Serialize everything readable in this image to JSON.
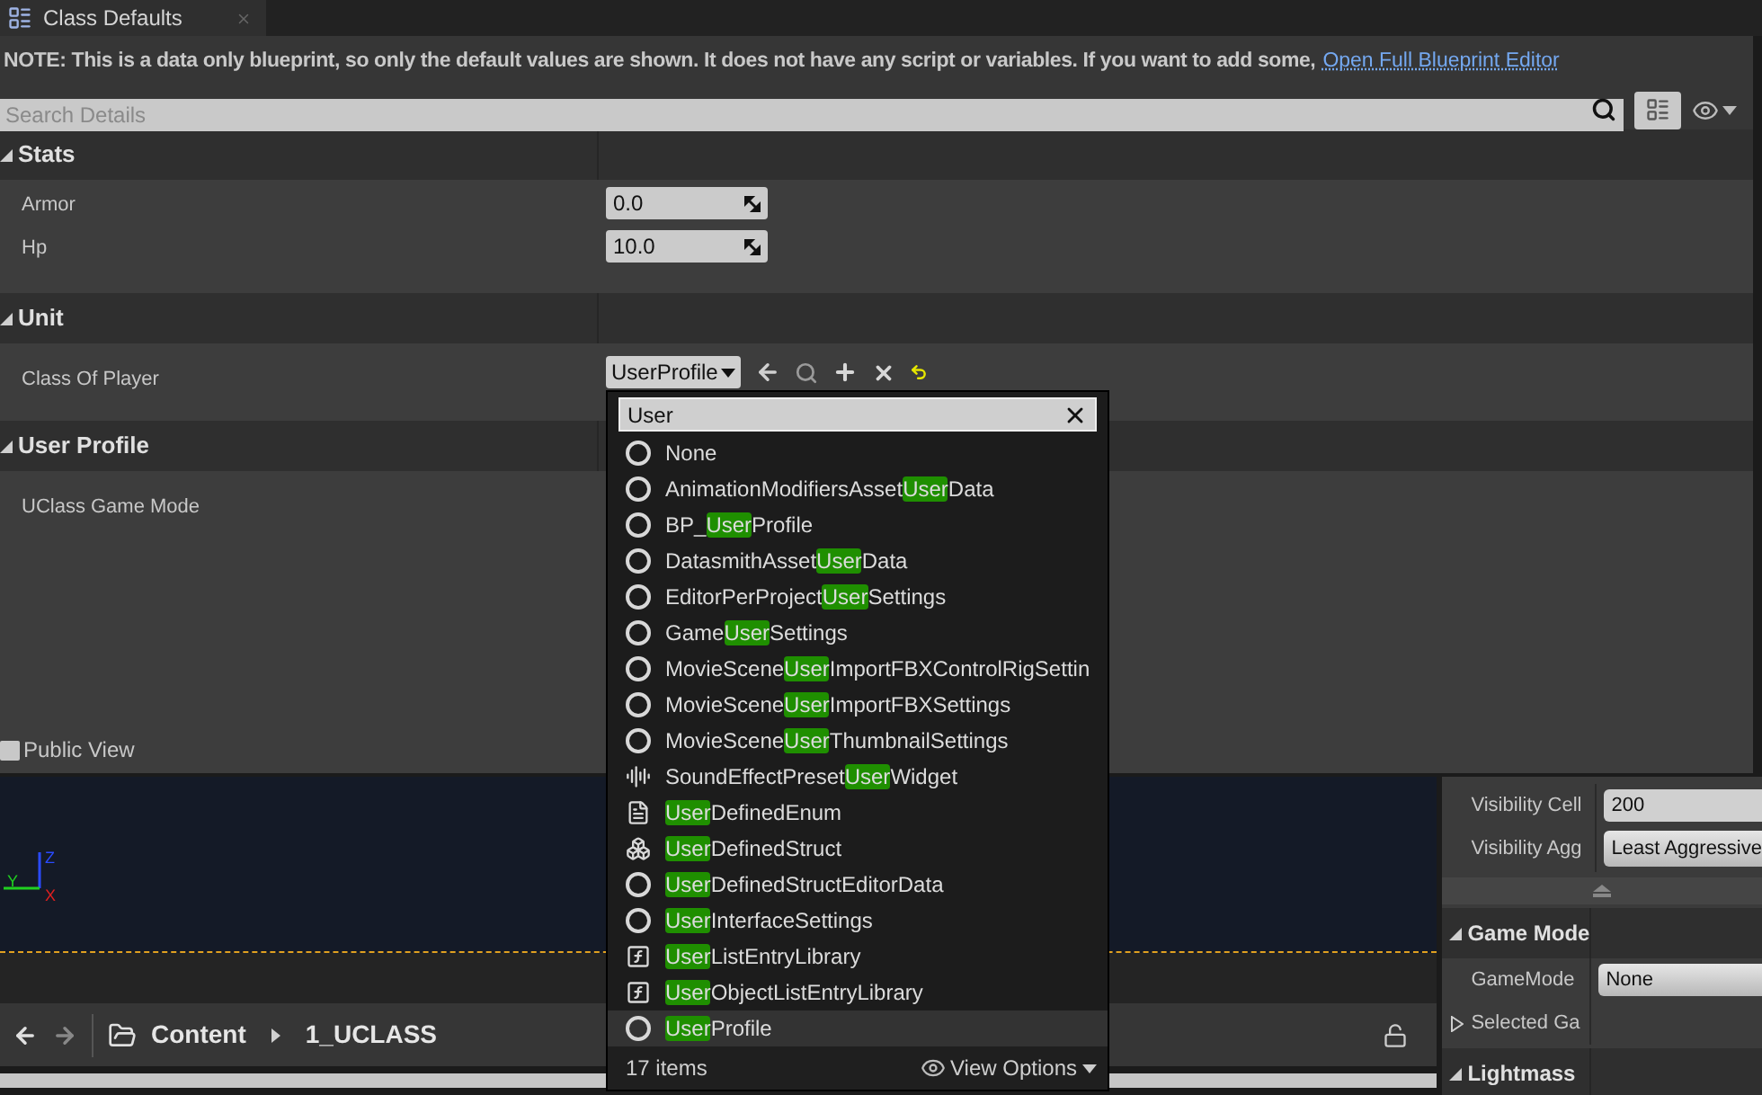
{
  "tab": {
    "title": "Class Defaults"
  },
  "note": {
    "text": "NOTE: This is a data only blueprint, so only the default values are shown.  It does not have any script or variables.  If you want to add some,",
    "link": "Open Full Blueprint Editor"
  },
  "search": {
    "placeholder": "Search Details"
  },
  "sections": [
    {
      "title": "Stats",
      "expanded": true,
      "properties": [
        {
          "kind": "number",
          "label": "Armor",
          "value": "0.0"
        },
        {
          "kind": "number",
          "label": "Hp",
          "value": "10.0"
        }
      ]
    },
    {
      "title": "Unit",
      "expanded": true,
      "properties": [
        {
          "kind": "class",
          "label": "Class Of Player",
          "value": "UserProfile"
        }
      ]
    },
    {
      "title": "User Profile",
      "expanded": true,
      "properties": [
        {
          "kind": "empty",
          "label": "UClass Game Mode"
        }
      ]
    }
  ],
  "public_view": {
    "label": "Public View",
    "checked": false
  },
  "class_picker": {
    "search": "User",
    "items": [
      {
        "kind": "class",
        "before": "None",
        "selected": false
      },
      {
        "kind": "class",
        "before": "AnimationModifiersAsset",
        "match": "User",
        "after": "Data",
        "selected": false
      },
      {
        "kind": "class",
        "before": "BP_",
        "match": "User",
        "after": "Profile",
        "selected": false
      },
      {
        "kind": "class",
        "before": "DatasmithAsset",
        "match": "User",
        "after": "Data",
        "selected": false
      },
      {
        "kind": "class",
        "before": "EditorPerProject",
        "match": "User",
        "after": "Settings",
        "selected": false
      },
      {
        "kind": "class",
        "before": "Game",
        "match": "User",
        "after": "Settings",
        "selected": false
      },
      {
        "kind": "class",
        "before": "MovieScene",
        "match": "User",
        "after": "ImportFBXControlRigSettin",
        "selected": false
      },
      {
        "kind": "class",
        "before": "MovieScene",
        "match": "User",
        "after": "ImportFBXSettings",
        "selected": false
      },
      {
        "kind": "class",
        "before": "MovieScene",
        "match": "User",
        "after": "ThumbnailSettings",
        "selected": false
      },
      {
        "kind": "sound",
        "before": "SoundEffectPreset",
        "match": "User",
        "after": "Widget",
        "selected": false
      },
      {
        "kind": "enum",
        "match": "User",
        "after": "DefinedEnum",
        "selected": false
      },
      {
        "kind": "struct",
        "match": "User",
        "after": "DefinedStruct",
        "selected": false
      },
      {
        "kind": "class",
        "match": "User",
        "after": "DefinedStructEditorData",
        "selected": false
      },
      {
        "kind": "class",
        "match": "User",
        "after": "InterfaceSettings",
        "selected": false
      },
      {
        "kind": "function",
        "match": "User",
        "after": "ListEntryLibrary",
        "selected": false
      },
      {
        "kind": "function",
        "match": "User",
        "after": "ObjectListEntryLibrary",
        "selected": false
      },
      {
        "kind": "class",
        "match": "User",
        "after": "Profile",
        "selected": true
      }
    ],
    "count": "17 items",
    "view_options": "View Options"
  },
  "viewport": {
    "axis_labels": [
      "Z",
      "Y",
      "X"
    ]
  },
  "content_browser": {
    "path": [
      "Content",
      "1_UCLASS"
    ]
  },
  "world_settings": {
    "rows": [
      {
        "kind": "field",
        "label": "Visibility Cell",
        "value": "200"
      },
      {
        "kind": "dropdown",
        "label": "Visibility Agg",
        "value": "Least Aggressive"
      }
    ],
    "sections": [
      {
        "title": "Game Mode",
        "expanded": true,
        "rows": [
          {
            "kind": "dropdown",
            "label": "GameMode",
            "value": "None"
          },
          {
            "kind": "group",
            "label": "Selected Ga",
            "expanded": false
          }
        ]
      },
      {
        "title": "Lightmass",
        "expanded": true
      }
    ]
  }
}
